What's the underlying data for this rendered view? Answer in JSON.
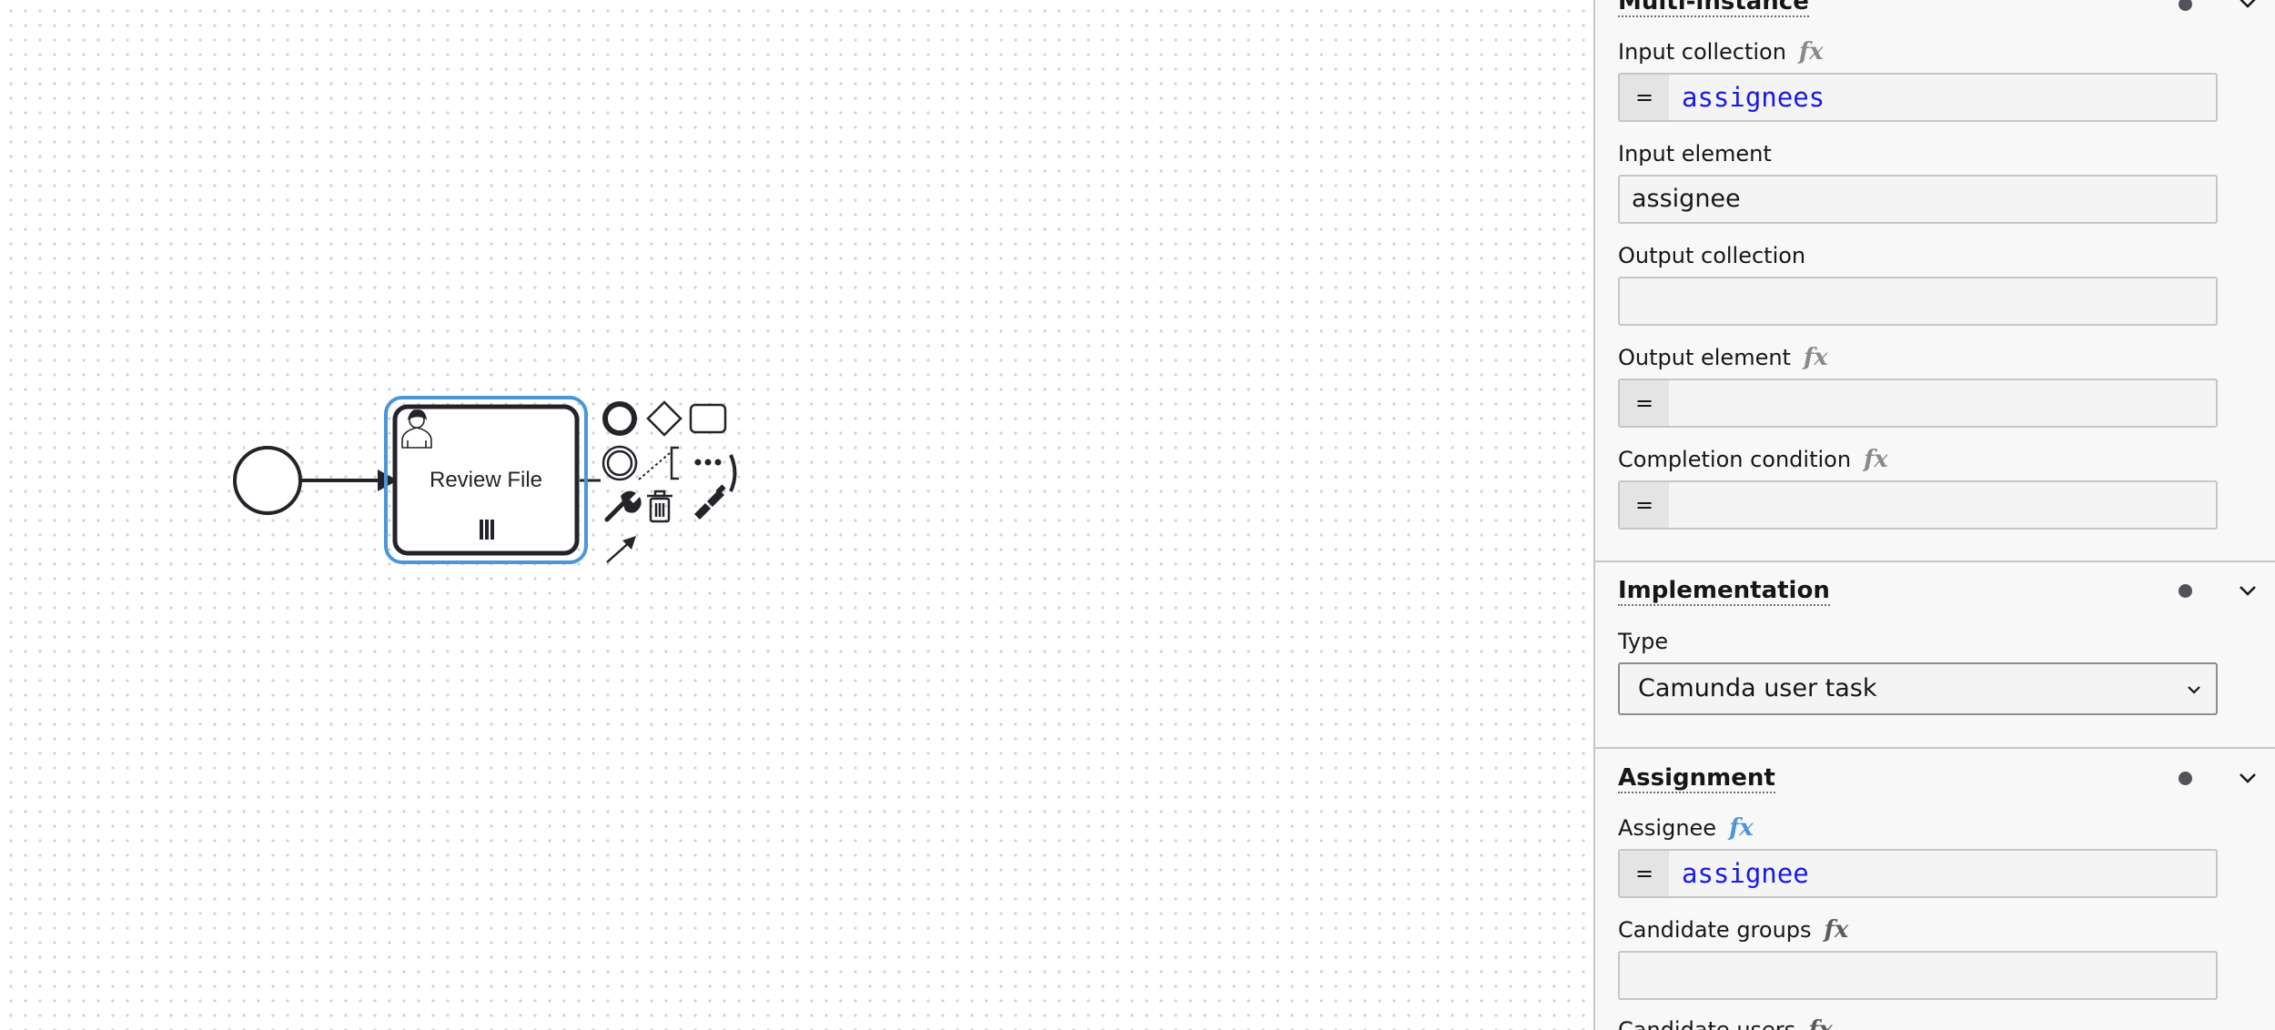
{
  "canvas": {
    "task": {
      "label": "Review File"
    }
  },
  "panel": {
    "multi_instance": {
      "title": "Multi-instance",
      "input_collection": {
        "label": "Input collection",
        "fx": "fx",
        "prefix": "=",
        "value": "assignees"
      },
      "input_element": {
        "label": "Input element",
        "value": "assignee"
      },
      "output_collection": {
        "label": "Output collection",
        "value": ""
      },
      "output_element": {
        "label": "Output element",
        "fx": "fx",
        "prefix": "=",
        "value": ""
      },
      "completion_condition": {
        "label": "Completion condition",
        "fx": "fx",
        "prefix": "=",
        "value": ""
      }
    },
    "implementation": {
      "title": "Implementation",
      "type": {
        "label": "Type",
        "selected": "Camunda user task"
      }
    },
    "assignment": {
      "title": "Assignment",
      "assignee": {
        "label": "Assignee",
        "fx": "fx",
        "prefix": "=",
        "value": "assignee"
      },
      "candidate_groups": {
        "label": "Candidate groups",
        "fx": "fx",
        "value": ""
      },
      "candidate_users": {
        "label": "Candidate users",
        "fx": "fx"
      }
    }
  },
  "colors": {
    "selection": "#4b96d8",
    "feel_value": "#1a1ae6",
    "fx_active": "#4b96d8",
    "fx_inactive": "#8a8a8a"
  }
}
